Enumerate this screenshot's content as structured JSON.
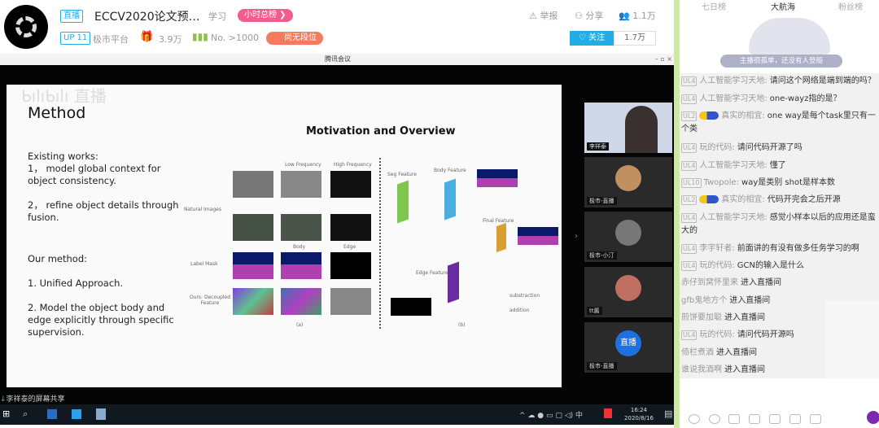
{
  "header": {
    "live_tag": "直播",
    "title": "ECCV2020论文预…",
    "category": "学习",
    "hour_rank": "小时总榜 ❯",
    "report": "举报",
    "share": "分享",
    "viewers": "1.1万",
    "up_level": "UP 11",
    "streamer": "极市平台",
    "gifts": "3.9万",
    "rank": "No. >1000",
    "tier": "尚无段位",
    "follow": "关注",
    "followers": "1.7万"
  },
  "meeting": {
    "title": "腾讯会议",
    "share_label": "李祥泰的屏幕共享",
    "participants": [
      {
        "name": "李祥泰"
      },
      {
        "name": "极市-直播"
      },
      {
        "name": "极市-小汀"
      },
      {
        "name": "tt酱"
      },
      {
        "name": "极市-直播",
        "badge": "直播"
      }
    ]
  },
  "slide": {
    "watermark": "直播",
    "heading": "Method",
    "existing": "Existing works:",
    "item1": "1，  model global context for object consistency.",
    "item2": "2，  refine object details through fusion.",
    "ours": "Our method:",
    "m1": "1. Unified Approach.",
    "m2": "2. Model the object body and edge explicitly through specific supervision.",
    "fig_title": "Motivation and Overview",
    "labels": {
      "low": "Low Frequency",
      "high": "High Frequency",
      "natural": "Natural Images",
      "label_mask": "Label Mask",
      "ours": "Ours: Decoupled Feature",
      "body": "Body",
      "edge": "Edge",
      "a": "(a)",
      "b": "(b)",
      "seg": "Seg Feature",
      "body_f": "Body Feature",
      "final": "Final Feature",
      "edge_f": "Edge Feature",
      "sub": "substraction",
      "add": "addition"
    }
  },
  "taskbar": {
    "time": "16:24",
    "date": "2020/8/16",
    "ime": "中"
  },
  "rank_tabs": [
    "七日榜",
    "大航海",
    "粉丝榜"
  ],
  "empty_banner": "主播很孤单，还没有人登船",
  "chat": [
    {
      "badge": "UL4",
      "user": "人工智能学习天地:",
      "text": "请问这个网络是端到端的吗？"
    },
    {
      "badge": "UL4",
      "user": "人工智能学习天地:",
      "text": "one-wayz指的是？"
    },
    {
      "badge": "UL2",
      "medal": true,
      "user": "真实的相宜:",
      "text": "one way是每个task里只有一个类"
    },
    {
      "badge": "UL4",
      "user": "玩的代码:",
      "text": "请问代码开源了吗"
    },
    {
      "badge": "UL4",
      "user": "人工智能学习天地:",
      "text": "懂了"
    },
    {
      "badge": "UL10",
      "user": "Twopole:",
      "text": "way是类别 shot是样本数"
    },
    {
      "badge": "UL2",
      "medal": true,
      "user": "真实的相宜:",
      "text": "代码开完会之后开源"
    },
    {
      "badge": "UL4",
      "user": "人工智能学习天地:",
      "text": "感觉小样本以后的应用还是蛮大的"
    },
    {
      "badge": "UL4",
      "user": "李宇轩者:",
      "text": "前面讲的有没有做多任务学习的啊"
    },
    {
      "badge": "UL4",
      "user": "玩的代码:",
      "text": "GCN的输入是什么"
    },
    {
      "user": "赤仔到窝怀里来",
      "text": "进入直播间"
    },
    {
      "user": "gfb鬼地方个",
      "text": "进入直播间"
    },
    {
      "user": "煎饼要加聪",
      "text": "进入直播间"
    },
    {
      "badge": "UL4",
      "user": "玩的代码:",
      "text": "请问代码开源吗"
    },
    {
      "user": "倚栏煮酒",
      "text": "进入直播间"
    },
    {
      "user": "谁说我酒啊",
      "text": "进入直播间"
    }
  ]
}
